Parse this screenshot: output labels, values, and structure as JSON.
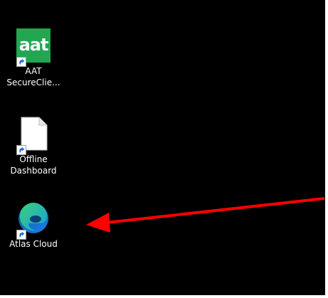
{
  "desktop": {
    "icons": [
      {
        "name": "aat-secureclient",
        "icon": "aat-logo-icon",
        "logo_text": "aat",
        "label_line1": "AAT",
        "label_line2": "SecureClie..."
      },
      {
        "name": "offline-dashboard",
        "icon": "blank-document-icon",
        "label_line1": "Offline",
        "label_line2": "Dashboard"
      },
      {
        "name": "atlas-cloud",
        "icon": "edge-browser-icon",
        "label_line1": "Atlas Cloud"
      }
    ],
    "annotation": {
      "icon": "red-arrow-icon",
      "color": "#ff0000"
    },
    "colors": {
      "background": "#000000",
      "aat_green": "#22a652",
      "arrow_red": "#ff0000"
    }
  }
}
